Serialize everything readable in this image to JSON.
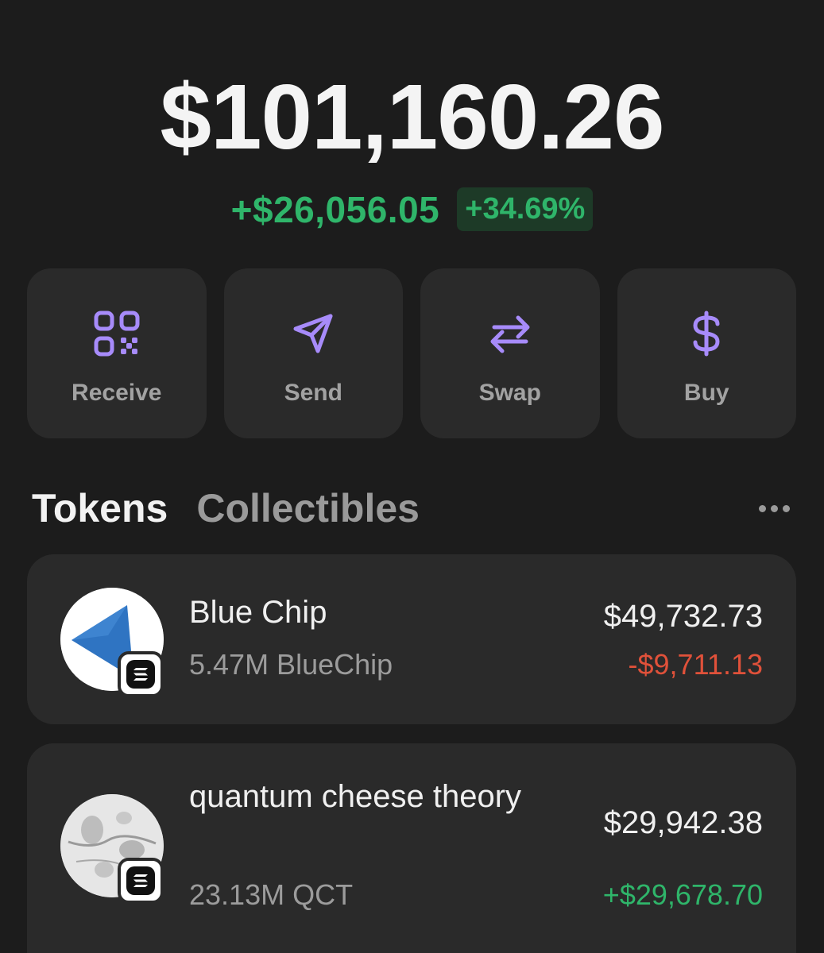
{
  "portfolio": {
    "balance": "$101,160.26",
    "change_amount": "+$26,056.05",
    "change_percent": "+34.69%"
  },
  "actions": [
    {
      "label": "Receive",
      "icon": "qr-code-icon"
    },
    {
      "label": "Send",
      "icon": "send-icon"
    },
    {
      "label": "Swap",
      "icon": "swap-icon"
    },
    {
      "label": "Buy",
      "icon": "dollar-icon"
    }
  ],
  "tabs": {
    "tokens": "Tokens",
    "collectibles": "Collectibles",
    "active": "Tokens"
  },
  "tokens": [
    {
      "name": "Blue Chip",
      "quantity": "5.47M BlueChip",
      "value": "$49,732.73",
      "change": "-$9,711.13",
      "change_direction": "down",
      "logo": "blue-chip-logo",
      "chain_badge": "solana-badge-icon"
    },
    {
      "name": "quantum cheese theory",
      "quantity": "23.13M QCT",
      "value": "$29,942.38",
      "change": "+$29,678.70",
      "change_direction": "up",
      "logo": "qct-logo",
      "chain_badge": "solana-badge-icon"
    }
  ],
  "colors": {
    "background": "#1c1c1c",
    "card": "#2a2a2a",
    "accent_purple": "#a78bfa",
    "positive": "#2fb56a",
    "negative": "#e0513a"
  }
}
